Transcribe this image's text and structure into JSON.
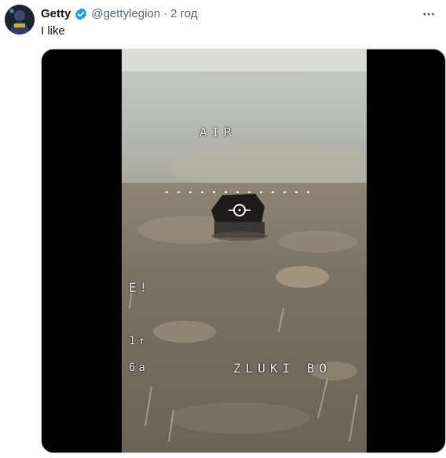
{
  "post": {
    "display_name": "Getty",
    "handle": "@gettylegion",
    "separator": "·",
    "time": "2 год",
    "text": "I like",
    "avatar_icon": "avatar-icon",
    "verified_icon": "verified-badge-icon",
    "more_icon": "more-options-icon",
    "verified_color": "#1d9bf0"
  },
  "video": {
    "overlay": {
      "air": "AIR",
      "alert": "E!",
      "line1": "1↑",
      "line2": "6a",
      "callsign": "ZLUKI BO"
    }
  }
}
